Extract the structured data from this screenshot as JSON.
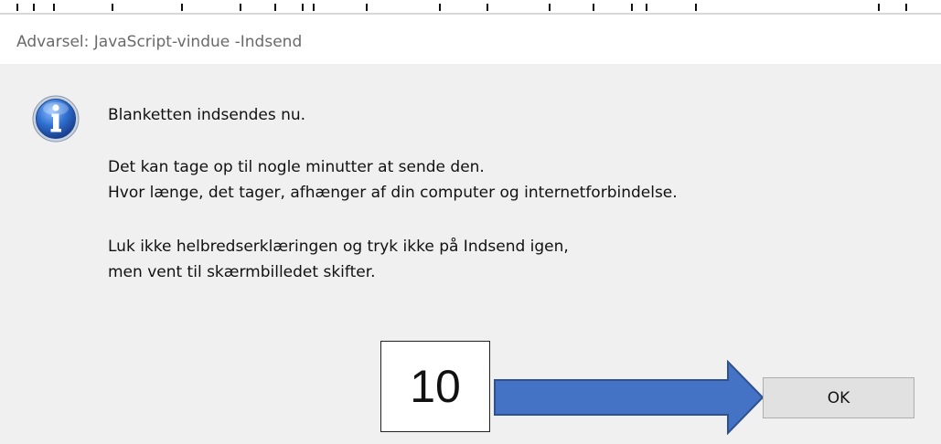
{
  "window": {
    "title": "Advarsel: JavaScript-vindue -Indsend"
  },
  "message": {
    "line1": "Blanketten indsendes nu.",
    "line2": "Det kan tage op til nogle minutter at sende den.",
    "line3": "Hvor længe, det tager, afhænger af din computer og internetforbindelse.",
    "line4": "Luk ikke helbredserklæringen og tryk ikke på Indsend igen,",
    "line5": "men vent til skærmbilledet skifter."
  },
  "icon": {
    "name": "info-icon",
    "color": "#2f6fd0"
  },
  "buttons": {
    "ok_label": "OK"
  },
  "annotation": {
    "step_number": "10",
    "arrow_color": "#4472c4"
  }
}
